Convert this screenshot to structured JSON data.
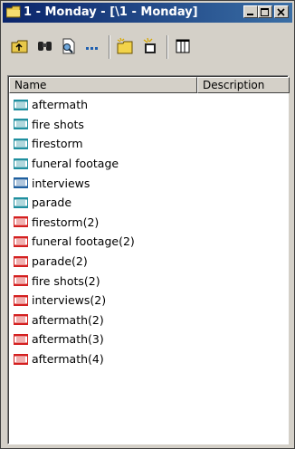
{
  "window": {
    "title": "1 - Monday - [\\1 - Monday]"
  },
  "toolbar": {
    "buttons": [
      {
        "icon": "folder-up-icon"
      },
      {
        "icon": "binoculars-icon"
      },
      {
        "icon": "find-document-icon"
      },
      {
        "icon": "dots-icon"
      },
      {
        "icon": "new-bin-icon"
      },
      {
        "icon": "new-clip-icon"
      },
      {
        "icon": "columns-view-icon"
      }
    ]
  },
  "list": {
    "columns": [
      "Name",
      "Description"
    ],
    "items": [
      {
        "name": "aftermath",
        "color": "#1f8f9f"
      },
      {
        "name": "fire shots",
        "color": "#1f8f9f"
      },
      {
        "name": "firestorm",
        "color": "#1f8f9f"
      },
      {
        "name": "funeral footage",
        "color": "#1f8f9f"
      },
      {
        "name": "interviews",
        "color": "#1f5f9f"
      },
      {
        "name": "parade",
        "color": "#1f8f9f"
      },
      {
        "name": "firestorm(2)",
        "color": "#d42020"
      },
      {
        "name": "funeral footage(2)",
        "color": "#d42020"
      },
      {
        "name": "parade(2)",
        "color": "#d42020"
      },
      {
        "name": "fire shots(2)",
        "color": "#d42020"
      },
      {
        "name": "interviews(2)",
        "color": "#d42020"
      },
      {
        "name": "aftermath(2)",
        "color": "#d42020"
      },
      {
        "name": "aftermath(3)",
        "color": "#d42020"
      },
      {
        "name": "aftermath(4)",
        "color": "#d42020"
      }
    ]
  }
}
